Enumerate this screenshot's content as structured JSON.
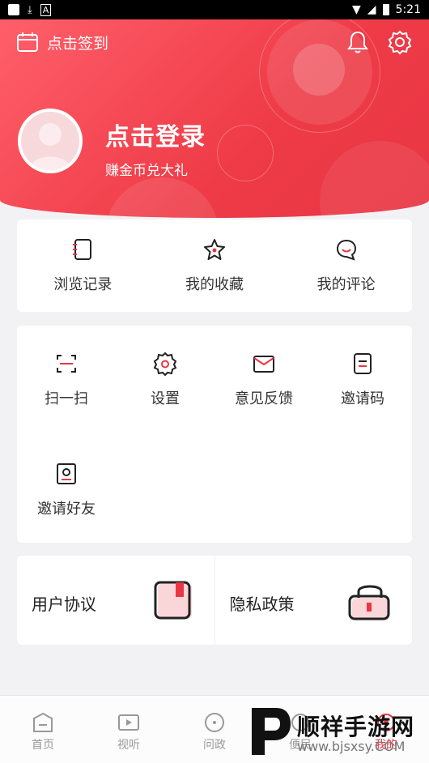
{
  "status_bar": {
    "time": "5:21"
  },
  "header": {
    "checkin_label": "点击签到",
    "login_title": "点击登录",
    "login_subtitle": "赚金币兑大礼",
    "accent_color": "#e93644"
  },
  "quick_actions": [
    {
      "label": "浏览记录",
      "icon": "notebook-icon"
    },
    {
      "label": "我的收藏",
      "icon": "star-icon"
    },
    {
      "label": "我的评论",
      "icon": "comment-icon"
    }
  ],
  "grid_items": [
    {
      "label": "扫一扫",
      "icon": "scan-icon"
    },
    {
      "label": "设置",
      "icon": "gear-icon"
    },
    {
      "label": "意见反馈",
      "icon": "mail-icon"
    },
    {
      "label": "邀请码",
      "icon": "document-icon"
    },
    {
      "label": "邀请好友",
      "icon": "contact-card-icon"
    }
  ],
  "links": [
    {
      "label": "用户协议",
      "icon": "agreement-icon"
    },
    {
      "label": "隐私政策",
      "icon": "lock-icon"
    }
  ],
  "bottom_nav": [
    {
      "label": "首页",
      "icon": "home-icon"
    },
    {
      "label": "视听",
      "icon": "video-icon"
    },
    {
      "label": "问政",
      "icon": "question-icon"
    },
    {
      "label": "便民",
      "icon": "service-icon"
    },
    {
      "label": "我的",
      "icon": "profile-icon"
    }
  ],
  "watermark": {
    "title": "顺祥手游网",
    "url": "www.bjsxsy.COM"
  }
}
